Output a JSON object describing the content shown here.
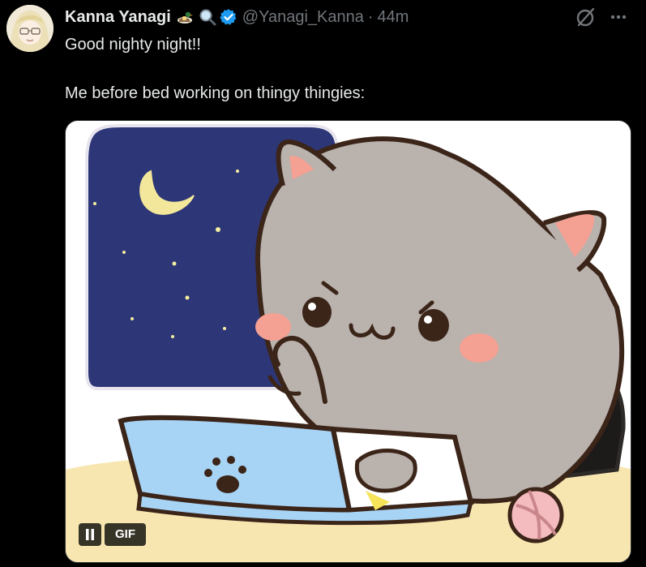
{
  "tweet": {
    "author": {
      "display_name": "Kanna Yanagi",
      "name_emojis": [
        "duck-emoji",
        "magnifier-emoji"
      ],
      "verified": true,
      "handle": "@Yanagi_Kanna"
    },
    "time_separator": "·",
    "timestamp": "44m",
    "text_lines": [
      "Good nighty night!!",
      "Me before bed working on thingy thingies:"
    ],
    "media": {
      "type": "gif",
      "badge_label": "GIF",
      "playing": true
    },
    "actions": {
      "grok_icon": "grok-icon",
      "more_icon": "more-icon"
    }
  },
  "colors": {
    "background": "#000000",
    "text_primary": "#e7e9ea",
    "text_secondary": "#71767b",
    "verified_blue": "#1d9bf0",
    "night_sky": "#2d3676",
    "cat_gray": "#b9b2ad",
    "laptop_blue": "#a7d3f5",
    "desk": "#f7e6b0"
  }
}
